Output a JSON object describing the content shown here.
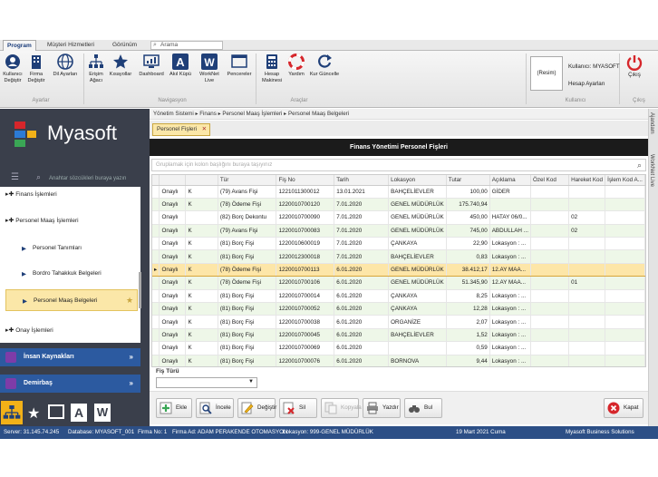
{
  "menu": {
    "tabs": [
      "Program",
      "Müşteri Hizmetleri",
      "Görünüm"
    ],
    "search_label": "Arama"
  },
  "ribbon": {
    "buttons": [
      {
        "label": "Kullanıcı Değiştir",
        "icon": "user-icon"
      },
      {
        "label": "Firma Değiştir",
        "icon": "building-icon"
      },
      {
        "label": "Dil Ayarları",
        "icon": "globe-icon"
      },
      {
        "label": "Erişim Ağacı",
        "icon": "hierarchy-icon"
      },
      {
        "label": "Kısayollar",
        "icon": "star-icon"
      },
      {
        "label": "Dashboard",
        "icon": "dashboard-icon"
      },
      {
        "label": "Akıl Küpü",
        "icon": "a-letter-icon"
      },
      {
        "label": "WorkNet Live",
        "icon": "w-letter-icon"
      },
      {
        "label": "Pencereler",
        "icon": "windows-icon"
      },
      {
        "label": "Hesap Makinesi",
        "icon": "calculator-icon"
      },
      {
        "label": "Yardım",
        "icon": "lifebuoy-icon"
      },
      {
        "label": "Kur Güncelle",
        "icon": "refresh-icon"
      }
    ],
    "groups": [
      "Ayarlar",
      "Navigasyon",
      "Araçlar",
      "Kullanıcı",
      "Çıkış"
    ],
    "resim": "(Resim)",
    "user_label": "Kullanıcı: MYASOFT",
    "account_settings": "Hesap Ayarları",
    "exit_label": "Çıkış"
  },
  "left": {
    "logo_text": "Myasoft",
    "search_placeholder": "Anahtar sözcükleri buraya yazın",
    "tree": [
      {
        "label": "Finans İşlemleri"
      },
      {
        "label": "Personel Maaş İşlemleri"
      },
      {
        "label": "Personel Tanımları"
      },
      {
        "label": "Bordro Tahakkuk Belgeleri"
      },
      {
        "label": "Personel Maaş Belgeleri"
      },
      {
        "label": "Onay İşlemleri"
      }
    ],
    "nav_ik": "İnsan Kaynakları",
    "nav_demirbas": "Demirbaş"
  },
  "breadcrumb": [
    "Yönetim Sistemi",
    "Finans",
    "Personel Maaş İşlemleri",
    "Personel Maaş Belgeleri"
  ],
  "doc_tab": "Personel Fişleri",
  "grid": {
    "title": "Finans Yönetimi Personel Fişleri",
    "filter_placeholder": "Gruplamak için kolon başlığını buraya taşıyınız",
    "columns": [
      "",
      "",
      "",
      "Tür",
      "Fiş No",
      "Tarih",
      "Lokasyon",
      "Tutar",
      "Açıklama",
      "Özel Kod",
      "Hareket Kod",
      "İşlem Kod A..."
    ],
    "rows": [
      [
        "",
        "Onaylı",
        "K",
        "(79) Avans Fişi",
        "1221011300012",
        "13.01.2021",
        "BAHÇELİEVLER",
        "100,00",
        "GİDER",
        "",
        "",
        ""
      ],
      [
        "",
        "Onaylı",
        "K",
        "(78) Ödeme Fişi",
        "1220010700120",
        "7.01.2020",
        "GENEL MÜDÜRLÜK",
        "175.740,94",
        "",
        "",
        "",
        ""
      ],
      [
        "",
        "Onaylı",
        "",
        "(82) Borç Dekontu",
        "1220010700090",
        "7.01.2020",
        "GENEL MÜDÜRLÜK",
        "450,00",
        "HATAY 06/0...",
        "",
        "02",
        ""
      ],
      [
        "",
        "Onaylı",
        "K",
        "(79) Avans Fişi",
        "1220010700083",
        "7.01.2020",
        "GENEL MÜDÜRLÜK",
        "745,00",
        "ABDULLAH ...",
        "",
        "02",
        ""
      ],
      [
        "",
        "Onaylı",
        "K",
        "(81) Borç Fişi",
        "1220010600019",
        "7.01.2020",
        "ÇANKAYA",
        "22,90",
        "Lokasyon : ...",
        "",
        "",
        ""
      ],
      [
        "",
        "Onaylı",
        "K",
        "(81) Borç Fişi",
        "1220012300018",
        "7.01.2020",
        "BAHÇELİEVLER",
        "0,83",
        "Lokasyon : ...",
        "",
        "",
        ""
      ],
      [
        "▸",
        "Onaylı",
        "K",
        "(78) Ödeme Fişi",
        "1220010700113",
        "6.01.2020",
        "GENEL MÜDÜRLÜK",
        "38.412,17",
        "12.AY MAA...",
        "",
        "",
        ""
      ],
      [
        "",
        "Onaylı",
        "K",
        "(78) Ödeme Fişi",
        "1220010700106",
        "6.01.2020",
        "GENEL MÜDÜRLÜK",
        "51.345,90",
        "12.AY MAA...",
        "",
        "01",
        ""
      ],
      [
        "",
        "Onaylı",
        "K",
        "(81) Borç Fişi",
        "1220010700014",
        "6.01.2020",
        "ÇANKAYA",
        "8,25",
        "Lokasyon : ...",
        "",
        "",
        ""
      ],
      [
        "",
        "Onaylı",
        "K",
        "(81) Borç Fişi",
        "1220010700052",
        "6.01.2020",
        "ÇANKAYA",
        "12,28",
        "Lokasyon : ...",
        "",
        "",
        ""
      ],
      [
        "",
        "Onaylı",
        "K",
        "(81) Borç Fişi",
        "1220010700038",
        "6.01.2020",
        "ORGANİZE",
        "2,07",
        "Lokasyon : ...",
        "",
        "",
        ""
      ],
      [
        "",
        "Onaylı",
        "K",
        "(81) Borç Fişi",
        "1220010700045",
        "6.01.2020",
        "BAHÇELİEVLER",
        "1,52",
        "Lokasyon : ...",
        "",
        "",
        ""
      ],
      [
        "",
        "Onaylı",
        "K",
        "(81) Borç Fişi",
        "1220010700069",
        "6.01.2020",
        "",
        "0,59",
        "Lokasyon : ...",
        "",
        "",
        ""
      ],
      [
        "",
        "Onaylı",
        "K",
        "(81) Borç Fişi",
        "1220010700076",
        "6.01.2020",
        "BORNOVA",
        "9,44",
        "Lokasyon : ...",
        "",
        "",
        ""
      ]
    ]
  },
  "fis_turu_label": "Fiş Türü",
  "actions": {
    "ekle": "Ekle",
    "incele": "İncele",
    "degistir": "Değiştir",
    "sil": "Sil",
    "kopyala": "Kopyala",
    "yazdir": "Yazdır",
    "bul": "Bul",
    "kapat": "Kapat"
  },
  "right_strip": [
    "Ajandam",
    "WorkNet Live"
  ],
  "status": {
    "server": "Server: 31.145.74.245",
    "database": "Database: MYASOFT_001",
    "firma_no": "Firma No: 1",
    "firma_ad": "Firma Ad: ADAM PERAKENDE OTOMASYON",
    "lokasyon": "Lokasyon: 999-GENEL MÜDÜRLÜK",
    "date": "19 Mart 2021 Cuma",
    "company": "Myasoft Business Solutions"
  },
  "colors": {
    "brand_blue": "#2c5aa0",
    "selection": "#fde6a8",
    "sidebar": "#3a3f4b",
    "close_red": "#d6262b"
  }
}
